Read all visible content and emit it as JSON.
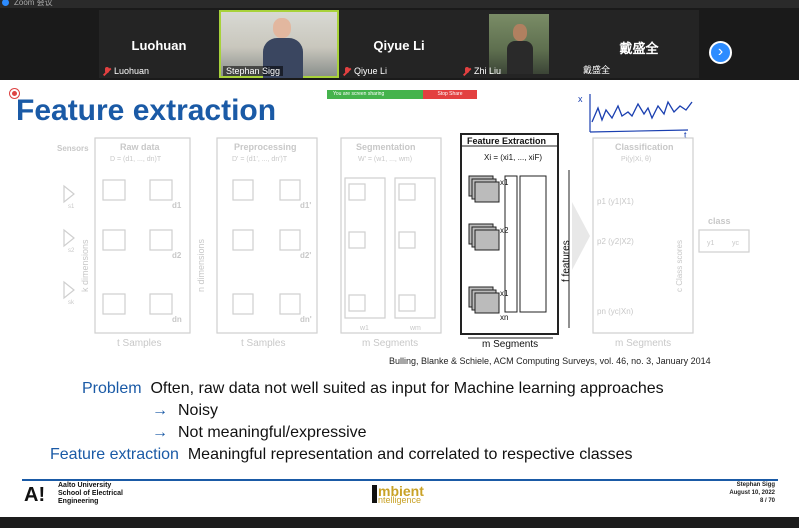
{
  "window": {
    "title": "Zoom 会议"
  },
  "gallery": {
    "participants": [
      {
        "name": "Luohuan",
        "caption": "Luohuan",
        "muted": true,
        "video": false
      },
      {
        "name": "Stephan Sigg",
        "caption": "Stephan Sigg",
        "muted": false,
        "video": true,
        "active": true
      },
      {
        "name": "Qiyue Li",
        "caption": "Qiyue Li",
        "muted": true,
        "video": false
      },
      {
        "name": "Zhi Liu",
        "caption": "Zhi Liu",
        "muted": true,
        "video": true
      },
      {
        "name": "戴盛全",
        "caption": "戴盛全",
        "muted": false,
        "video": false
      }
    ],
    "next_icon": "chevron-right-icon"
  },
  "share_bar": {
    "status": "You are screen sharing",
    "stop_label": "Stop Share"
  },
  "slide": {
    "title": "Feature extraction",
    "diagram": {
      "sensors_label": "Sensors",
      "sensor_marks": [
        "s1",
        "s2",
        "sk"
      ],
      "k_dim": "k dimensions",
      "n_dim": "n dimensions",
      "raw_title": "Raw data",
      "raw_formula": "D = (d1, ..., dn)T",
      "raw_d": [
        "d1",
        "d2",
        "dn"
      ],
      "t_samples": "t Samples",
      "pre_title": "Preprocessing",
      "pre_formula": "D' = (d1', ..., dn')T",
      "pre_d": [
        "d1'",
        "d2'",
        "dn'"
      ],
      "t_samples2": "t Samples",
      "seg_title": "Segmentation",
      "seg_formula": "W' = (w1, ..., wm)",
      "seg_w": [
        "w1",
        "wm"
      ],
      "m_segments": "m Segments",
      "fe_title": "Feature Extraction",
      "fe_formula": "Xi = (xi1, ..., xiF)",
      "fe_marks": [
        "x1",
        "x2",
        "x1",
        "xn"
      ],
      "m_segments2": "m Segments",
      "f_features": "f features",
      "cl_title": "Classification",
      "cl_formula": "Pi(y|Xi, θ)",
      "cl_rows": [
        "p1 (y1|X1)",
        "p2 (y2|X2)",
        "pn (yc|Xn)"
      ],
      "c_scores": "c Class scores",
      "class_label": "class",
      "class_values": [
        "y1",
        "yc"
      ],
      "m_segments3": "m Segments"
    },
    "citation": "Bulling, Blanke & Schiele, ACM Computing Surveys, vol. 46, no. 3, January 2014",
    "problem_term": "Problem",
    "problem_text": "Often, raw data not well suited as input for Machine learning approaches",
    "arrow": "→",
    "point1": "Noisy",
    "point2": "Not meaningful/expressive",
    "fe_term": "Feature extraction",
    "fe_text": "Meaningful representation and correlated to respective classes",
    "annotation": {
      "x_label": "x",
      "t_label": "t"
    },
    "footer": {
      "logo": "A!",
      "university": [
        "Aalto University",
        "School of Electrical",
        "Engineering"
      ],
      "ambient1": "mbient",
      "ambient2": "ntelligence",
      "author": "Stephan Sigg",
      "date": "August 10, 2022",
      "page": "8 / 70"
    }
  }
}
